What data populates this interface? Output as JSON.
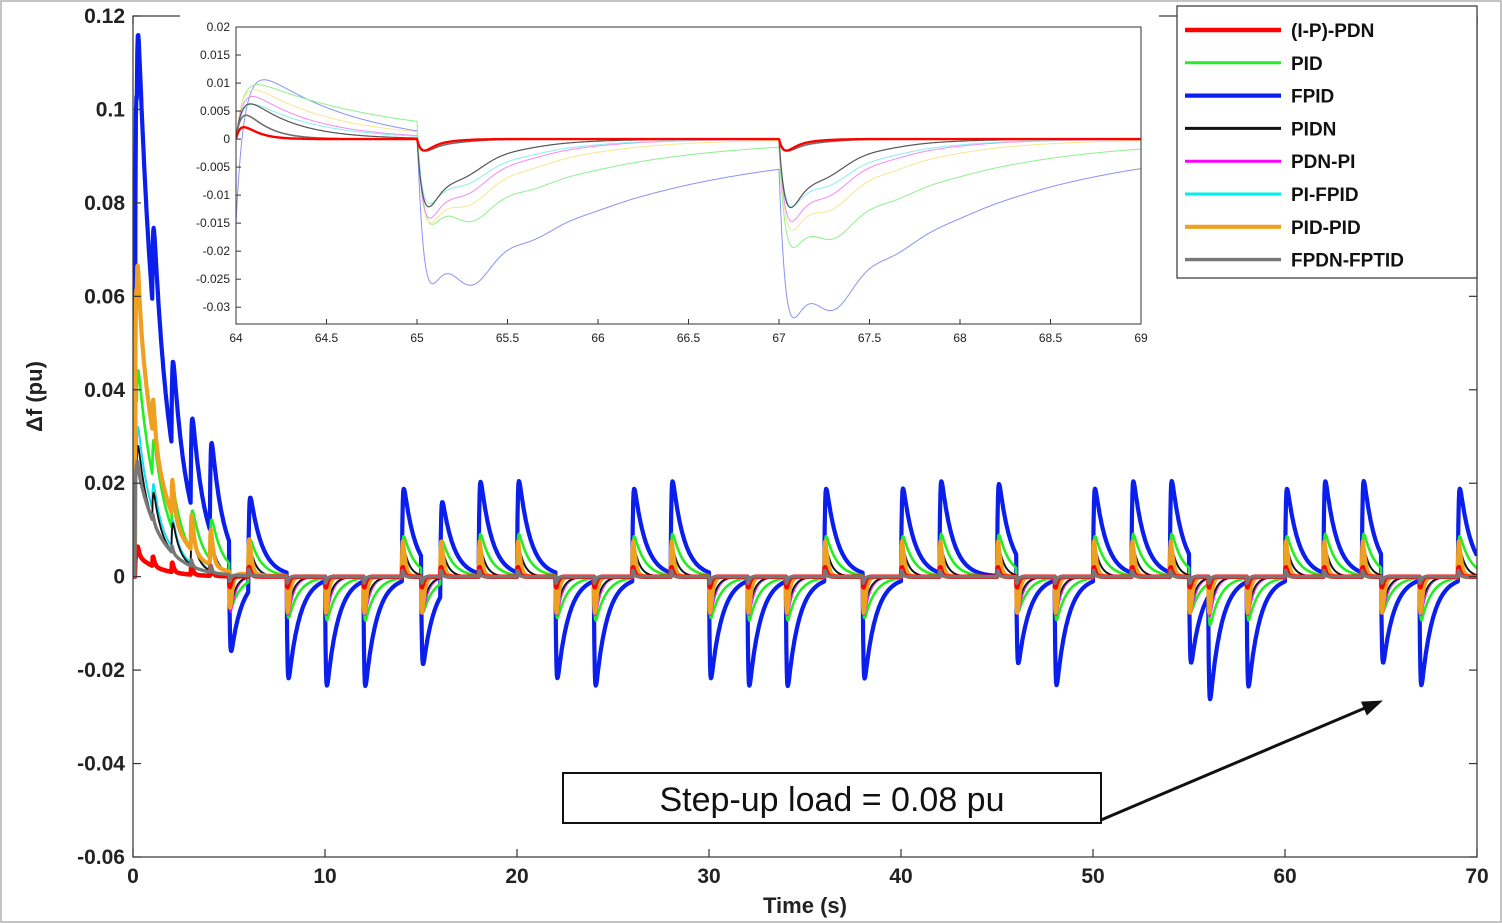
{
  "chart_data": [
    {
      "type": "line",
      "xlabel": "Time (s)",
      "ylabel": "Δf (pu)",
      "xlim": [
        0,
        70
      ],
      "ylim": [
        -0.06,
        0.12
      ],
      "x_ticks": [
        "0",
        "10",
        "20",
        "30",
        "40",
        "50",
        "60",
        "70"
      ],
      "y_ticks": [
        "-0.06",
        "-0.04",
        "-0.02",
        "0",
        "0.02",
        "0.04",
        "0.06",
        "0.08",
        "0.1",
        "0.12"
      ],
      "grid": false,
      "legend_position": "top-right",
      "step_times": [
        0.2,
        1,
        2,
        3,
        4,
        5,
        6,
        8,
        10,
        12,
        14,
        15,
        16,
        18,
        20,
        22,
        24,
        26,
        28,
        30,
        32,
        34,
        36,
        38,
        40,
        42,
        45,
        46,
        48,
        50,
        52,
        54,
        55,
        56,
        58,
        60,
        62,
        64,
        65,
        67,
        69
      ],
      "step_signs": [
        1,
        1,
        1,
        1,
        1,
        -1,
        1,
        -1,
        -1,
        -1,
        1,
        -1,
        1,
        1,
        1,
        -1,
        -1,
        1,
        1,
        -1,
        -1,
        -1,
        1,
        -1,
        1,
        1,
        1,
        -1,
        -1,
        1,
        1,
        1,
        -1,
        -1,
        -1,
        1,
        1,
        1,
        -1,
        -1,
        1
      ],
      "series": [
        {
          "name": "(I-P)-PDN",
          "color": "#ff0000",
          "width": 4.5,
          "peak_up": 0.0055,
          "peak_down": -0.006,
          "tau": 0.08
        },
        {
          "name": "PID",
          "color": "#22ee22",
          "width": 2.6,
          "peak_up": 0.0115,
          "peak_down": -0.0115,
          "tau": 0.55
        },
        {
          "name": "FPID",
          "color": "#0a1eee",
          "width": 4.2,
          "peak_up": 0.025,
          "peak_down": -0.028,
          "tau": 0.6
        },
        {
          "name": "PIDN",
          "color": "#111111",
          "width": 1.8,
          "peak_up": 0.0095,
          "peak_down": -0.0095,
          "tau": 0.3
        },
        {
          "name": "PDN-PI",
          "color": "#ff00ff",
          "width": 1.8,
          "peak_up": 0.009,
          "peak_down": -0.012,
          "tau": 0.3
        },
        {
          "name": "PI-FPID",
          "color": "#00eeee",
          "width": 1.8,
          "peak_up": 0.009,
          "peak_down": -0.01,
          "tau": 0.3
        },
        {
          "name": "PID-PID",
          "color": "#f0a020",
          "width": 4.2,
          "peak_up": 0.016,
          "peak_down": -0.016,
          "tau": 0.12
        },
        {
          "name": "FPDN-FPTID",
          "color": "#777777",
          "width": 3.4,
          "peak_up": 0.0045,
          "peak_down": -0.0045,
          "tau": 0.06
        }
      ],
      "initial_transient": {
        "time": 0.1,
        "values": [
          0.005,
          0.041,
          0.112,
          0.025,
          0.03,
          0.03,
          0.067,
          0.026
        ]
      },
      "annotation": {
        "text": "Step-up load = 0.08 pu",
        "arrow_target_x": 65.1,
        "arrow_target_y": -0.0265
      }
    },
    {
      "type": "line",
      "role": "inset-zoom",
      "xlim": [
        64,
        69
      ],
      "ylim": [
        -0.033,
        0.02
      ],
      "x_ticks": [
        "64",
        "64.5",
        "65",
        "65.5",
        "66",
        "66.5",
        "67",
        "67.5",
        "68",
        "68.5",
        "69"
      ],
      "y_ticks": [
        "-0.03",
        "-0.025",
        "-0.02",
        "-0.015",
        "-0.01",
        "-0.005",
        "0",
        "0.005",
        "0.01",
        "0.015",
        "0.02"
      ],
      "events": [
        {
          "time": 64.0,
          "sign": 1
        },
        {
          "time": 65.0,
          "sign": -1
        },
        {
          "time": 67.0,
          "sign": -1
        }
      ],
      "series": [
        {
          "name": "(I-P)-PDN",
          "color": "#ff0000",
          "width": 2.4,
          "peak_up": 0.0055,
          "peak_down": -0.0055,
          "tau": 0.08,
          "offset": 0
        },
        {
          "name": "PID",
          "color": "#8ef08e",
          "width": 1,
          "peak_up": 0.012,
          "peak_down": -0.024,
          "tau": 0.75,
          "offset": 0
        },
        {
          "name": "FPID",
          "color": "#8a92f5",
          "width": 1,
          "peak_up": 0.017,
          "peak_down": -0.035,
          "tau": 0.9,
          "offset": -0.015
        },
        {
          "name": "PIDN",
          "color": "#555555",
          "width": 1.2,
          "peak_up": 0.01,
          "peak_down": -0.02,
          "tau": 0.25,
          "offset": 0
        },
        {
          "name": "PDN-PI",
          "color": "#f58af5",
          "width": 1,
          "peak_up": 0.011,
          "peak_down": -0.022,
          "tau": 0.35,
          "offset": 0
        },
        {
          "name": "PI-FPID",
          "color": "#8aeeee",
          "width": 1,
          "peak_up": 0.009,
          "peak_down": -0.018,
          "tau": 0.35,
          "offset": 0
        },
        {
          "name": "PID-PID",
          "color": "#f5e890",
          "width": 1,
          "peak_up": 0.012,
          "peak_down": -0.023,
          "tau": 0.45,
          "offset": 0
        },
        {
          "name": "FPDN-FPTID",
          "color": "#707070",
          "width": 1.6,
          "peak_up": 0.009,
          "peak_down": -0.0045,
          "tau": 0.12,
          "offset": 0
        }
      ]
    }
  ]
}
